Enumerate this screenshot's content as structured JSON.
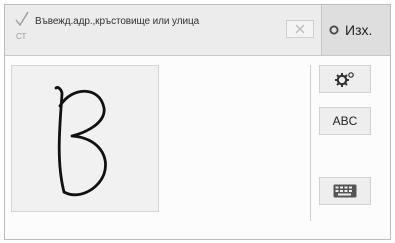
{
  "input": {
    "text": "Въвежд.адр.,кръстовище или улица",
    "hint": "СТ"
  },
  "toolbar": {
    "exit_label": "Изх."
  },
  "side": {
    "abc_label": "ABC"
  },
  "canvas": {
    "drawn_glyph": "B"
  },
  "icons": {
    "confirm": "check-icon",
    "clear": "clear-icon",
    "exit": "exit-icon",
    "settings": "gear-icon",
    "keyboard": "keyboard-icon"
  },
  "colors": {
    "topbar": "#ececec",
    "exit_button": "#dedede",
    "canvas": "#f1f1f1",
    "ink": "#111111"
  }
}
